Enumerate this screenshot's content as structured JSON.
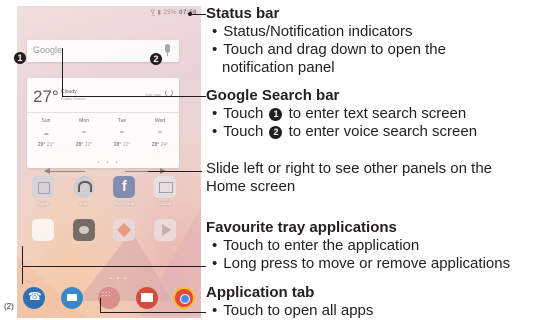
{
  "figure_number": "(2)",
  "phone": {
    "status_icons": "∇̲ ▮ 25%",
    "time": "07:56",
    "search_placeholder": "Google",
    "weather": {
      "temp": "27°",
      "condition": "Cloudy",
      "location": "Futian District",
      "updated": "Just now",
      "days": [
        {
          "name": "Sun",
          "high": "29°",
          "low": "23°"
        },
        {
          "name": "Mon",
          "high": "28°",
          "low": "22°"
        },
        {
          "name": "Tue",
          "high": "28°",
          "low": "22°"
        },
        {
          "name": "Wed",
          "high": "28°",
          "low": "24°"
        }
      ]
    },
    "apps_row1": [
      {
        "label": "Apps",
        "icon": "apps-folder-icon"
      },
      {
        "label": "Mix",
        "icon": "mix-headphones-icon"
      },
      {
        "label": "Facebook",
        "icon": "facebook-icon"
      },
      {
        "label": "Gmail",
        "icon": "whatsapp-icon"
      }
    ],
    "apps_row2": [
      {
        "label": "",
        "icon": "tools-folder-icon"
      },
      {
        "label": "",
        "icon": "camera-icon"
      },
      {
        "label": "",
        "icon": "photos-icon"
      },
      {
        "label": "",
        "icon": "play-store-icon"
      }
    ],
    "tray": [
      "phone-icon",
      "messaging-icon",
      "application-tab-icon",
      "email-icon",
      "chrome-icon"
    ]
  },
  "markers": {
    "one": "1",
    "two": "2"
  },
  "annotations": {
    "status_bar": {
      "title": "Status bar",
      "bullets": [
        "Status/Notification indicators",
        "Touch and drag down to open the"
      ],
      "continuation": "notification panel"
    },
    "search_bar": {
      "title": "Google Search bar",
      "bullet1_pre": "Touch",
      "bullet1_post": "to enter text search screen",
      "bullet2_pre": "Touch",
      "bullet2_post": "to enter voice search screen"
    },
    "slide": {
      "line1": "Slide left or right to see other panels on the",
      "line2": "Home screen"
    },
    "favourite": {
      "title": "Favourite tray applications",
      "bullets": [
        "Touch to enter the application",
        "Long press to move or remove applications"
      ]
    },
    "app_tab": {
      "title": "Application tab",
      "bullets": [
        "Touch to open all apps"
      ]
    }
  }
}
